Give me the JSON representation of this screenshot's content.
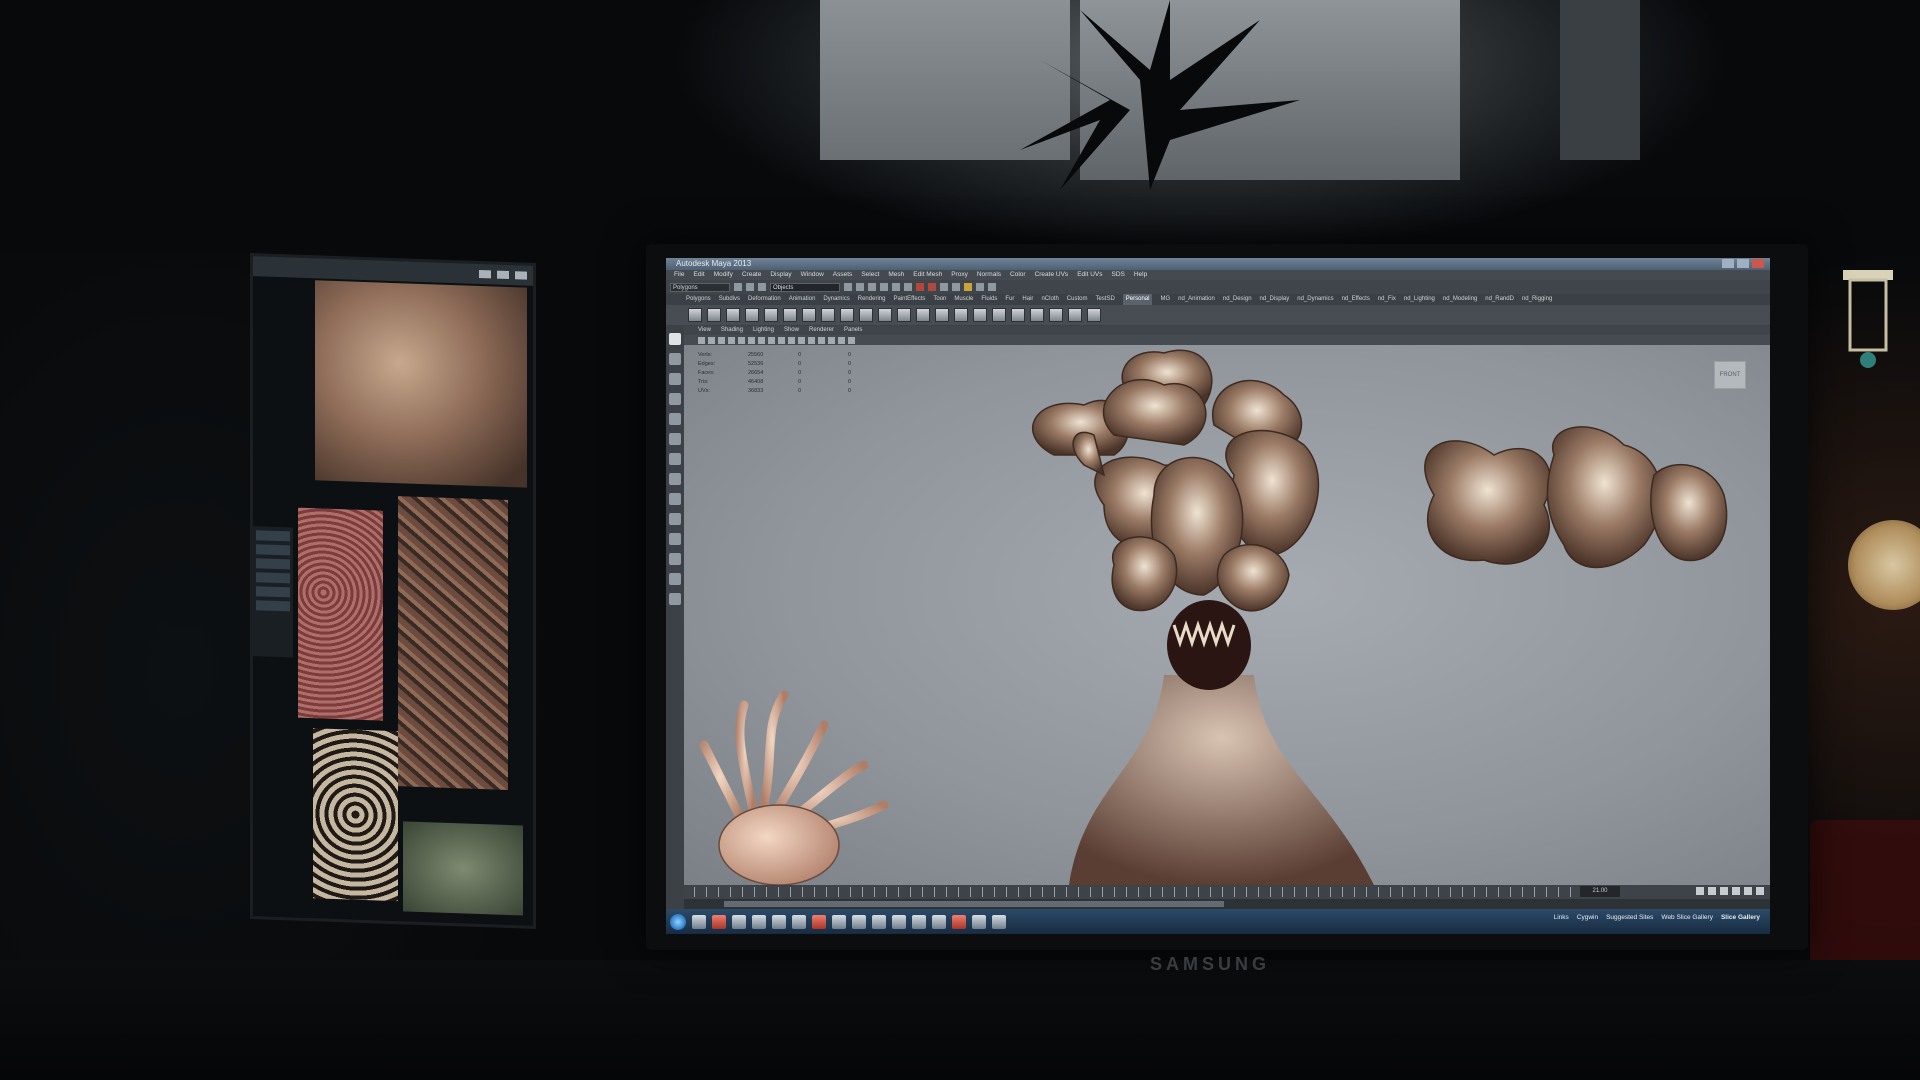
{
  "app": {
    "title": "Autodesk Maya 2013",
    "menus": [
      "File",
      "Edit",
      "Modify",
      "Create",
      "Display",
      "Window",
      "Assets",
      "Select",
      "Mesh",
      "Edit Mesh",
      "Proxy",
      "Normals",
      "Color",
      "Create UVs",
      "Edit UVs",
      "SDS",
      "Help"
    ],
    "mode_selector": "Polygons",
    "selection_field": "Objects"
  },
  "shelf_tabs": {
    "items": [
      "Polygons",
      "Subdivs",
      "Deformation",
      "Animation",
      "Dynamics",
      "Rendering",
      "PaintEffects",
      "Toon",
      "Muscle",
      "Fluids",
      "Fur",
      "Hair",
      "nCloth",
      "Custom",
      "TestSD",
      "Personal",
      "MG",
      "nd_Animation",
      "nd_Design",
      "nd_Display",
      "nd_Dynamics",
      "nd_Effects",
      "nd_Fix",
      "nd_Lighting",
      "nd_Modeling",
      "nd_RandD",
      "nd_Rigging"
    ],
    "active_index": 15
  },
  "panel_menu": [
    "View",
    "Shading",
    "Lighting",
    "Show",
    "Renderer",
    "Panels"
  ],
  "hud": {
    "rows": [
      {
        "label": "Verts:",
        "v1": "25560",
        "v2": "0",
        "v3": "0"
      },
      {
        "label": "Edges:",
        "v1": "52536",
        "v2": "0",
        "v3": "0"
      },
      {
        "label": "Faces:",
        "v1": "26654",
        "v2": "0",
        "v3": "0"
      },
      {
        "label": "Tris:",
        "v1": "46408",
        "v2": "0",
        "v3": "0"
      },
      {
        "label": "UVs:",
        "v1": "36833",
        "v2": "0",
        "v3": "0"
      }
    ]
  },
  "view_cube": {
    "label": "FRONT"
  },
  "timeslider": {
    "current_frame": "21.00",
    "tick_label": "21",
    "start_label": "1.00"
  },
  "taskbar": {
    "tray": [
      "Links",
      "Cygwin",
      "Suggested Sites",
      "Web Slice Gallery",
      "Slice Gallery"
    ]
  },
  "monitor": {
    "brand": "SAMSUNG"
  },
  "colors": {
    "viewport_bg": "#9aa0a6",
    "taskbar": "#1e3550",
    "active_tab": "#5a636b"
  }
}
